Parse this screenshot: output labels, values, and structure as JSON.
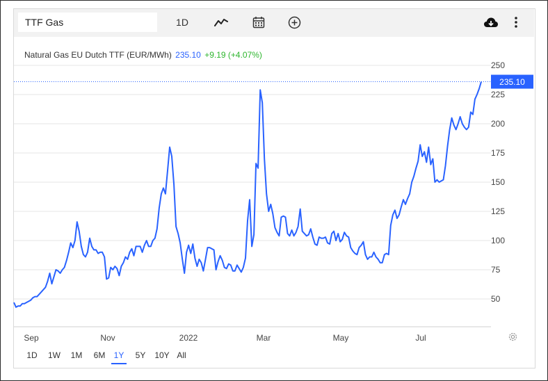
{
  "toolbar": {
    "search_value": "TTF Gas",
    "period_label": "1D",
    "icons": [
      "line-chart-icon",
      "calendar-icon",
      "add-circle-icon",
      "cloud-download-icon",
      "more-vert-icon"
    ]
  },
  "header": {
    "title": "Natural Gas EU Dutch TTF (EUR/MWh)",
    "price": "235.10",
    "change": "+9.19 (+4.07%)"
  },
  "range_buttons": [
    "1D",
    "1W",
    "1M",
    "6M",
    "1Y",
    "5Y",
    "10Y",
    "All"
  ],
  "active_range": "1Y",
  "colors": {
    "line": "#2962ff",
    "price_tag_bg": "#2962ff",
    "change_positive": "#2db52d",
    "grid": "#e6e6e6"
  },
  "chart_data": {
    "type": "line",
    "title": "Natural Gas EU Dutch TTF (EUR/MWh)",
    "xlabel": "",
    "ylabel": "",
    "ylim": [
      30,
      260
    ],
    "y_ticks": [
      50,
      75,
      100,
      125,
      150,
      175,
      200,
      225,
      250
    ],
    "x_tick_labels": [
      "Sep",
      "Nov",
      "2022",
      "Mar",
      "May",
      "Jul"
    ],
    "last_price_label": "235.10",
    "grid": true,
    "legend": "none",
    "series": [
      {
        "values": [
          47,
          43,
          44,
          44,
          46,
          46,
          47,
          48,
          49,
          51,
          52,
          52,
          54,
          56,
          58,
          60,
          65,
          72,
          63,
          69,
          75,
          74,
          72,
          75,
          77,
          83,
          90,
          98,
          94,
          100,
          116,
          108,
          95,
          88,
          86,
          90,
          102,
          95,
          92,
          92,
          89,
          90,
          90,
          86,
          67,
          68,
          77,
          75,
          78,
          76,
          70,
          78,
          81,
          86,
          84,
          90,
          93,
          87,
          95,
          95,
          95,
          90,
          96,
          100,
          95,
          95,
          100,
          102,
          110,
          128,
          140,
          145,
          140,
          160,
          180,
          172,
          148,
          112,
          106,
          98,
          84,
          72,
          90,
          96,
          89,
          97,
          85,
          78,
          84,
          81,
          74,
          84,
          94,
          94,
          93,
          92,
          75,
          82,
          87,
          83,
          77,
          76,
          80,
          79,
          74,
          74,
          79,
          76,
          73,
          77,
          85,
          117,
          135,
          95,
          105,
          166,
          162,
          229,
          218,
          170,
          140,
          125,
          131,
          123,
          111,
          107,
          104,
          120,
          121,
          120,
          106,
          104,
          109,
          104,
          107,
          112,
          127,
          108,
          106,
          104,
          105,
          110,
          103,
          97,
          96,
          103,
          102,
          102,
          103,
          98,
          97,
          106,
          108,
          100,
          106,
          99,
          101,
          107,
          104,
          103,
          94,
          91,
          89,
          88,
          94,
          96,
          99,
          88,
          84,
          86,
          86,
          90,
          86,
          84,
          81,
          81,
          88,
          89,
          88,
          113,
          122,
          126,
          119,
          122,
          129,
          135,
          131,
          136,
          140,
          150,
          155,
          162,
          168,
          182,
          172,
          176,
          167,
          180,
          165,
          170,
          150,
          152,
          150,
          151,
          152,
          164,
          181,
          195,
          205,
          199,
          195,
          200,
          206,
          200,
          197,
          195,
          197,
          210,
          208,
          221,
          225,
          230,
          236
        ]
      }
    ]
  }
}
